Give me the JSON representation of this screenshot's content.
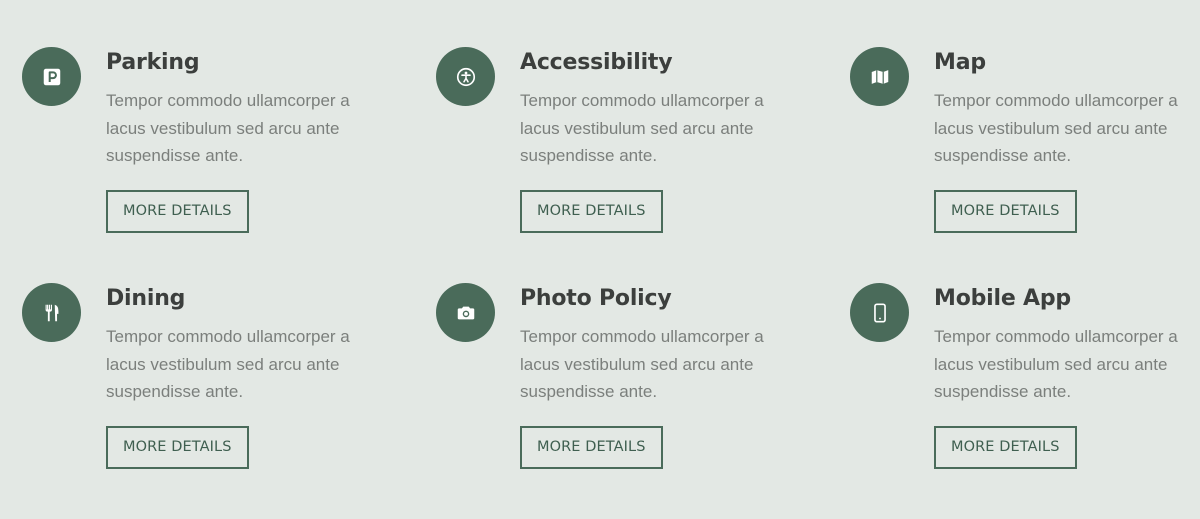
{
  "features": [
    {
      "title": "Parking",
      "icon": "parking-icon",
      "description": "Tempor commodo ullamcorper a lacus vestibulum sed arcu ante suspendisse ante.",
      "button_label": "MORE DETAILS"
    },
    {
      "title": "Accessibility",
      "icon": "accessibility-icon",
      "description": "Tempor commodo ullamcorper a lacus vestibulum sed arcu ante suspendisse ante.",
      "button_label": "MORE DETAILS"
    },
    {
      "title": "Map",
      "icon": "map-icon",
      "description": "Tempor commodo ullamcorper a lacus vestibulum sed arcu ante suspendisse ante.",
      "button_label": "MORE DETAILS"
    },
    {
      "title": "Dining",
      "icon": "dining-icon",
      "description": "Tempor commodo ullamcorper a lacus vestibulum sed arcu ante suspendisse ante.",
      "button_label": "MORE DETAILS"
    },
    {
      "title": "Photo Policy",
      "icon": "camera-icon",
      "description": "Tempor commodo ullamcorper a lacus vestibulum sed arcu ante suspendisse ante.",
      "button_label": "MORE DETAILS"
    },
    {
      "title": "Mobile App",
      "icon": "mobile-phone-icon",
      "description": "Tempor commodo ullamcorper a lacus vestibulum sed arcu ante suspendisse ante.",
      "button_label": "MORE DETAILS"
    }
  ],
  "colors": {
    "background": "#e3e8e4",
    "accent": "#4a6b5a",
    "title_text": "#3c3f3d",
    "body_text": "#7b7f7c"
  }
}
